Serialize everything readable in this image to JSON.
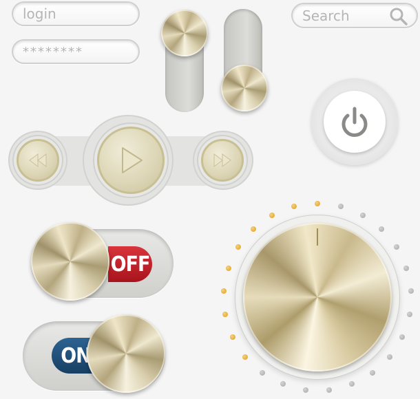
{
  "login": {
    "placeholder": "login"
  },
  "password": {
    "value": "********"
  },
  "search": {
    "placeholder": "Search",
    "icon": "search-icon"
  },
  "vertical_toggles": [
    {
      "state": "up"
    },
    {
      "state": "down"
    }
  ],
  "power": {
    "icon": "power-icon"
  },
  "media": {
    "prev_icon": "rewind-icon",
    "play_icon": "play-icon",
    "next_icon": "fast-forward-icon"
  },
  "off_toggle": {
    "label": "OFF",
    "color": "#c8232c"
  },
  "on_toggle": {
    "label": "ON",
    "color": "#1f4f7a"
  },
  "knob": {
    "total_dots": 25,
    "active_dots": 10,
    "active_color": "#e8b23c",
    "inactive_color": "#b8b8b8"
  }
}
